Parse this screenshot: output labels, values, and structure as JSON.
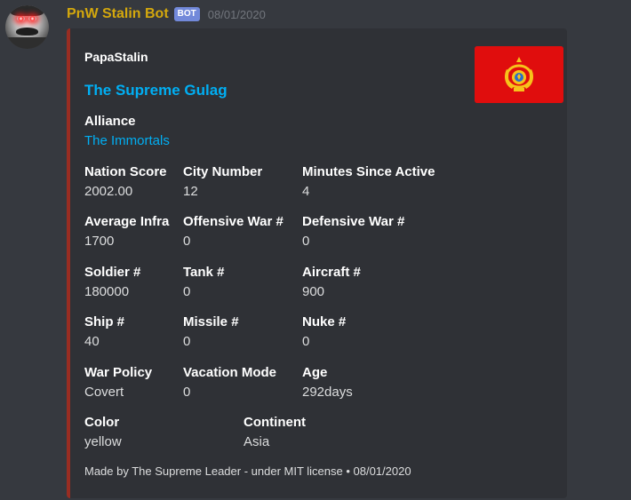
{
  "message": {
    "username": "PnW Stalin Bot",
    "bot_tag": "BOT",
    "timestamp": "08/01/2020",
    "username_color": "#d4a80d",
    "avatar_icon": "stalin-avatar-icon"
  },
  "embed": {
    "accent_color": "#992d22",
    "author": "PapaStalin",
    "title": "The Supreme Gulag",
    "thumbnail_icon": "red-flag-emblem-icon",
    "fields": [
      {
        "name": "Alliance",
        "value": "The Immortals"
      },
      {
        "name": "Nation Score",
        "value": "2002.00"
      },
      {
        "name": "City Number",
        "value": "12"
      },
      {
        "name": "Minutes Since Active",
        "value": "4"
      },
      {
        "name": "Average Infra",
        "value": "1700"
      },
      {
        "name": "Offensive War #",
        "value": "0"
      },
      {
        "name": "Defensive War #",
        "value": "0"
      },
      {
        "name": "Soldier #",
        "value": "180000"
      },
      {
        "name": "Tank #",
        "value": "0"
      },
      {
        "name": "Aircraft #",
        "value": "900"
      },
      {
        "name": "Ship #",
        "value": "40"
      },
      {
        "name": "Missile #",
        "value": "0"
      },
      {
        "name": "Nuke #",
        "value": "0"
      },
      {
        "name": "War Policy",
        "value": "Covert"
      },
      {
        "name": "Vacation Mode",
        "value": "0"
      },
      {
        "name": "Age",
        "value": "292days"
      },
      {
        "name": "Color",
        "value": "yellow"
      },
      {
        "name": "Continent",
        "value": "Asia"
      }
    ],
    "footer": "Made by The Supreme Leader - under MIT license • 08/01/2020"
  }
}
